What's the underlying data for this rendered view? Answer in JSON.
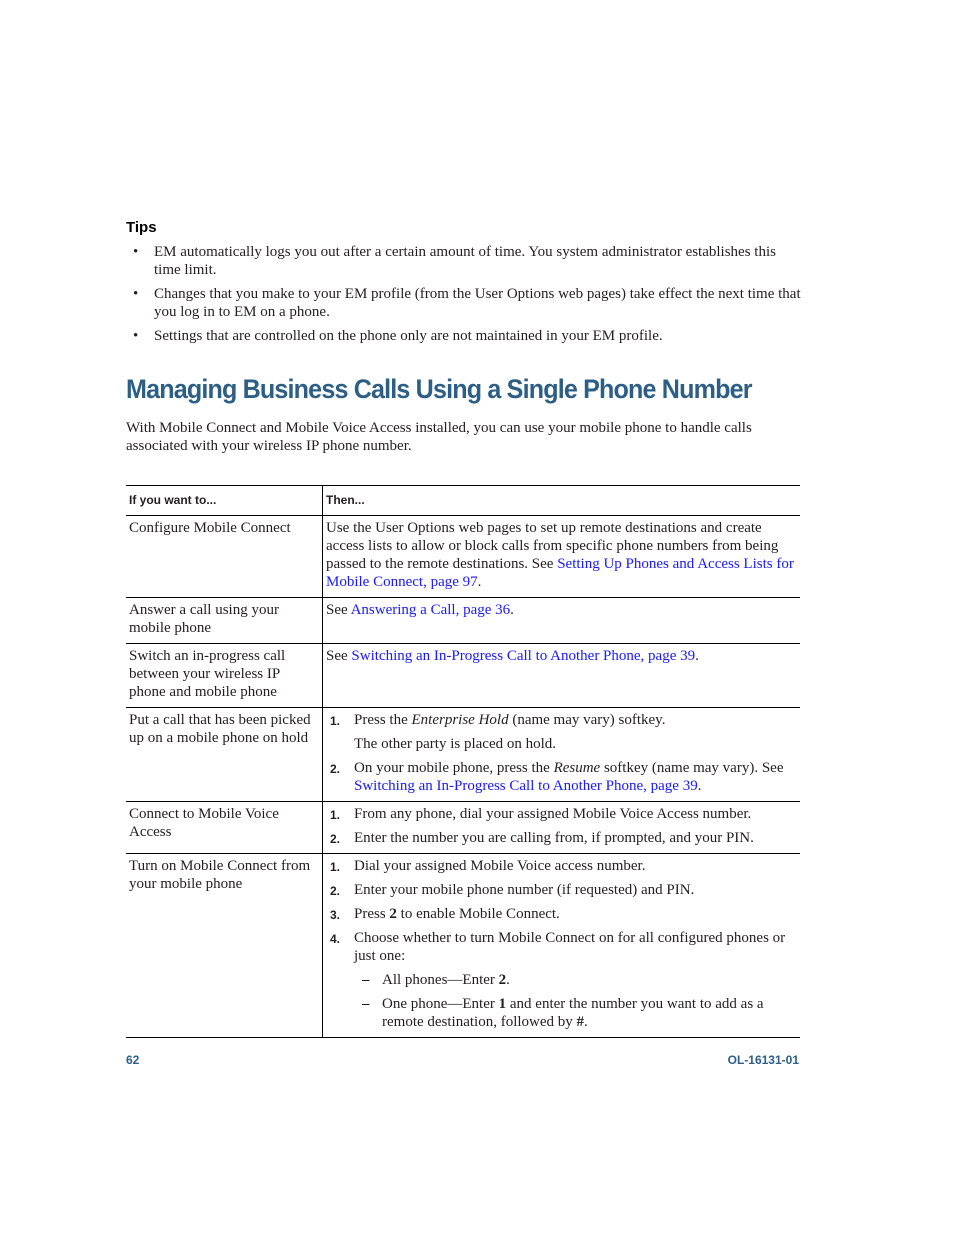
{
  "tips": {
    "heading": "Tips",
    "items": [
      "EM automatically logs you out after a certain amount of time. You system administrator establishes this time limit.",
      "Changes that you make to your EM profile (from the User Options web pages) take effect the next time that you log in to EM on a phone.",
      "Settings that are controlled on the phone only are not maintained in your EM profile."
    ],
    "bullet": "•"
  },
  "section": {
    "title": "Managing Business Calls Using a Single Phone Number",
    "intro": "With Mobile Connect and Mobile Voice Access installed, you can use your mobile phone to handle calls associated with your wireless IP phone number."
  },
  "table": {
    "headers": [
      "If you want to...",
      "Then..."
    ],
    "rows": [
      {
        "task": "Configure Mobile Connect",
        "text": "Use the User Options web pages to set up remote destinations and create access lists to allow or block calls from specific phone numbers from being passed to the remote destinations. See ",
        "link": "Setting Up Phones and Access Lists for Mobile Connect, page 97",
        "after": "."
      },
      {
        "task": "Answer a call using your mobile phone",
        "text": "See ",
        "link": "Answering a Call, page 36",
        "after": "."
      },
      {
        "task": "Switch an in-progress call between your wireless IP phone and mobile phone",
        "text": "See ",
        "link": "Switching an In-Progress Call to Another Phone, page 39",
        "after": "."
      },
      {
        "task": "Put a call that has been picked up on a mobile phone on hold",
        "steps": [
          {
            "num": "1.",
            "pre": "Press the ",
            "em": "Enterprise Hold",
            "post": " (name may vary) softkey.",
            "sub": "The other party is placed on hold."
          },
          {
            "num": "2.",
            "pre": "On your mobile phone, press the ",
            "em": "Resume",
            "post": " softkey (name may vary). See ",
            "link": "Switching an In-Progress Call to Another Phone, page 39",
            "after": "."
          }
        ]
      },
      {
        "task": "Connect to Mobile Voice Access",
        "steps": [
          {
            "num": "1.",
            "text": "From any phone, dial your assigned Mobile Voice Access number."
          },
          {
            "num": "2.",
            "text": "Enter the number you are calling from, if prompted, and your PIN."
          }
        ]
      },
      {
        "task": "Turn on Mobile Connect from your mobile phone",
        "steps": [
          {
            "num": "1.",
            "text": "Dial your assigned Mobile Voice access number."
          },
          {
            "num": "2.",
            "text": "Enter your mobile phone number (if requested) and PIN."
          },
          {
            "num": "3.",
            "pre": "Press ",
            "bold": "2",
            "post": " to enable Mobile Connect."
          },
          {
            "num": "4.",
            "text": "Choose whether to turn Mobile Connect on for all configured phones or just one:",
            "options": [
              {
                "pre": "All phones—Enter ",
                "bold": "2",
                "post": "."
              },
              {
                "pre": "One phone—Enter ",
                "bold": "1",
                "post": " and enter the number you want to add as a remote destination, followed by ",
                "bold2": "#",
                "post2": "."
              }
            ]
          }
        ],
        "dash": "–"
      }
    ]
  },
  "footer": {
    "page_number": "62",
    "doc_id": "OL-16131-01"
  },
  "colors": {
    "heading_blue": "#2d5f86",
    "link_blue": "#1a1aff"
  }
}
